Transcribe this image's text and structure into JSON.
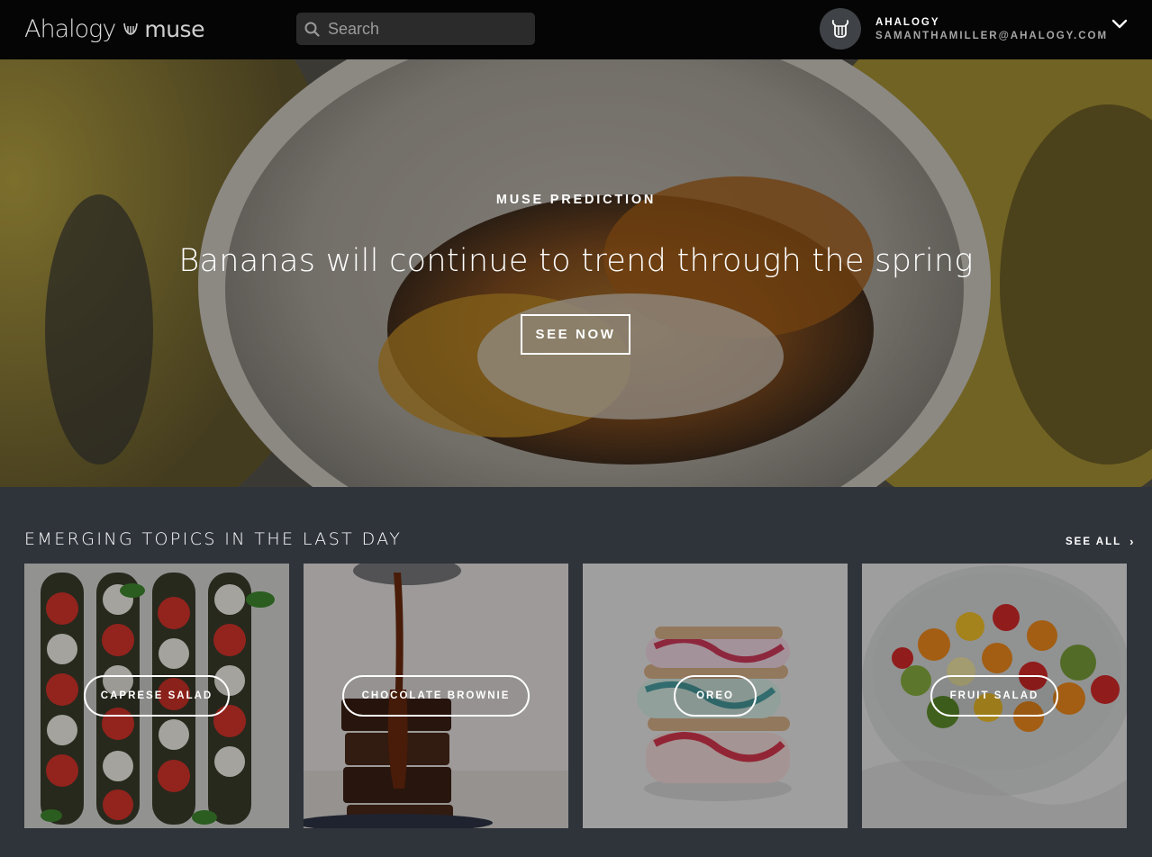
{
  "header": {
    "logo_brand": "Ahalogy",
    "logo_product": "muse",
    "search_placeholder": "Search",
    "account_name": "AHALOGY",
    "account_email": "SAMANTHAMILLER@AHALOGY.COM"
  },
  "hero": {
    "kicker": "MUSE PREDICTION",
    "title": "Bananas will continue to trend through the spring",
    "button_label": "SEE NOW"
  },
  "emerging": {
    "title": "EMERGING TOPICS IN THE LAST DAY",
    "see_all_label": "SEE ALL",
    "see_all_arrow": "›",
    "topics": [
      {
        "label": "CAPRESE SALAD"
      },
      {
        "label": "CHOCOLATE BROWNIE"
      },
      {
        "label": "OREO"
      },
      {
        "label": "FRUIT SALAD"
      }
    ]
  },
  "icons": {
    "search": "search-icon",
    "avatar": "lyre-icon",
    "menu": "chevron-down-icon",
    "logo_mark": "muse-lyre-icon"
  },
  "colors": {
    "topbar": "#050505",
    "page_background": "#2f343b",
    "search_background": "#2b2b2c",
    "avatar_background": "#3f4246"
  }
}
